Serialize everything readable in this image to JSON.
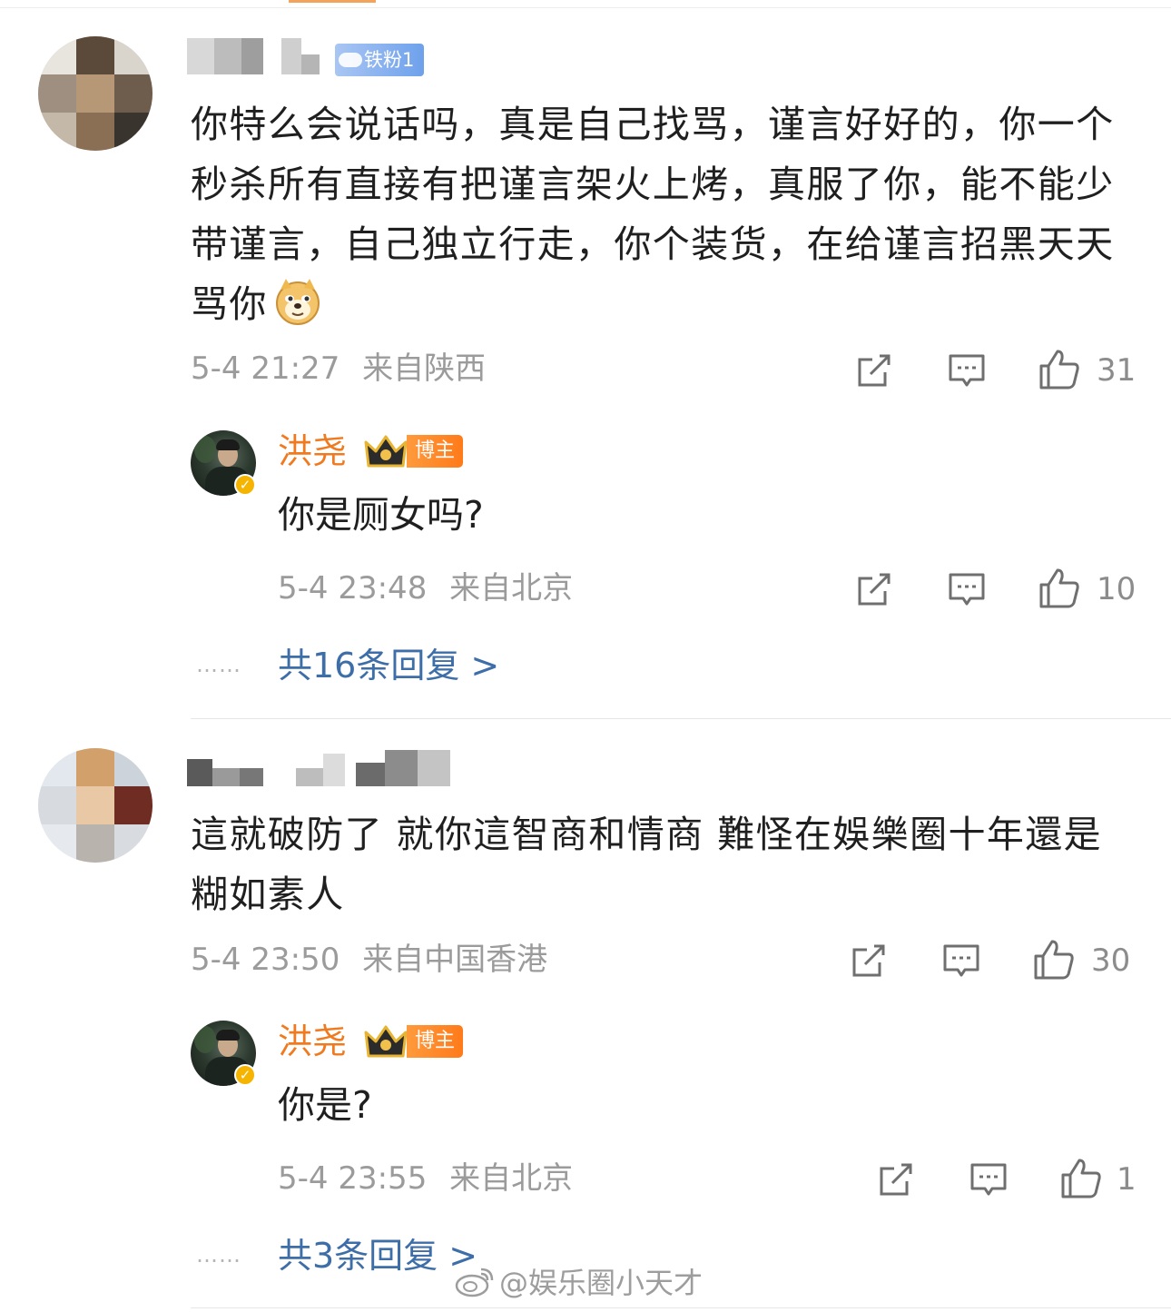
{
  "colors": {
    "accent_orange": "#f07a1f",
    "link_blue": "#3e6ea8",
    "meta_gray": "#9b9b9b",
    "fan_badge_blue": "#6ea1ec"
  },
  "comments": [
    {
      "fan_badge": "铁粉1",
      "text": "你特么会说话吗，真是自己找骂，谨言好好的，你一个秒杀所有直接有把谨言架火上烤，真服了你，能不能少带谨言，自己独立行走，你个装货，在给谨言招黑天天骂你",
      "emoji_icon": "doge-emoji-icon",
      "time": "5-4 21:27",
      "location": "来自陕西",
      "likes": "31",
      "reply": {
        "author": "洪尧",
        "badge": "博主",
        "text": "你是厕女吗?",
        "time": "5-4 23:48",
        "location": "来自北京",
        "likes": "10"
      },
      "dots": "……",
      "more_replies": "共16条回复 >"
    },
    {
      "text": "這就破防了 就你這智商和情商 難怪在娛樂圈十年還是糊如素人",
      "time": "5-4 23:50",
      "location": "来自中国香港",
      "likes": "30",
      "reply": {
        "author": "洪尧",
        "badge": "博主",
        "text": "你是?",
        "time": "5-4 23:55",
        "location": "来自北京",
        "likes": "1"
      },
      "dots": "……",
      "more_replies": "共3条回复 >"
    }
  ],
  "watermark": "@娱乐圈小天才"
}
